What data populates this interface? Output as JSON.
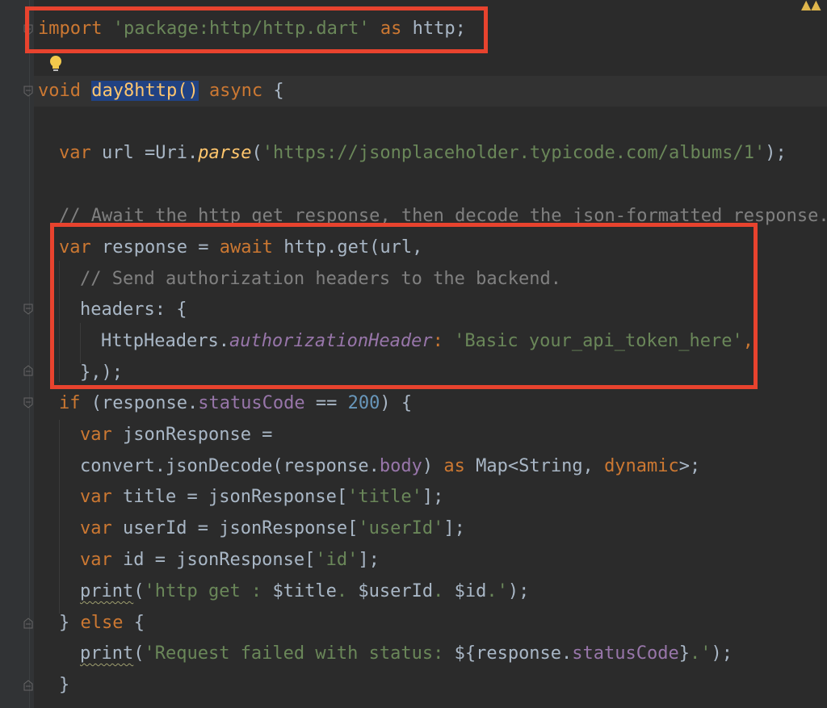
{
  "editor": {
    "warning_icon": "warning-icon",
    "bulb_icon": "lightbulb-icon",
    "lines": {
      "l1": {
        "kw1": "import",
        "str1": "'package:http/http.dart'",
        "kw2": "as",
        "rest": "http;"
      },
      "l3": {
        "kw": "void",
        "fn": "day8http()",
        "kw2": "async",
        "brace": "{"
      },
      "l5": {
        "kw": "var",
        "a": "url =Uri.",
        "m": "parse",
        "b": "(",
        "s": "'https://jsonplaceholder.typicode.com/albums/1'",
        "c": ");"
      },
      "l7": {
        "cm": "// Await the http get response, then decode the json-formatted response."
      },
      "l8": {
        "kw": "var",
        "a": "response =",
        "kw2": "await",
        "b": "http.get(url,",
        "c": ""
      },
      "l9": {
        "cm": "// Send authorization headers to the backend."
      },
      "l10": {
        "a": "headers: {"
      },
      "l11": {
        "a": "HttpHeaders.",
        "p": "authorizationHeader",
        "b": ":",
        "s": "'Basic your_api_token_here'",
        "c": ","
      },
      "l12": {
        "a": "},",
        "b": ");"
      },
      "l13": {
        "kw": "if",
        "a": "(response.",
        "p": "statusCode",
        "b": "==",
        "n": "200",
        "c": ") {"
      },
      "l14": {
        "kw": "var",
        "a": "jsonResponse ="
      },
      "l15": {
        "a": "convert.jsonDecode(response.",
        "p": "body",
        "b": ")",
        "kw": "as",
        "c": "Map<String,",
        "kw2": "dynamic",
        "d": ">;"
      },
      "l16": {
        "kw": "var",
        "a": "title = jsonResponse[",
        "s": "'title'",
        "b": "];"
      },
      "l17": {
        "kw": "var",
        "a": "userId = jsonResponse[",
        "s": "'userId'",
        "b": "];"
      },
      "l18": {
        "kw": "var",
        "a": "id = jsonResponse[",
        "s": "'id'",
        "b": "];"
      },
      "l19": {
        "f": "print",
        "a": "(",
        "s1": "'http get : ",
        "v": "$title",
        "s2": ". ",
        "v2": "$userId",
        "s3": ". ",
        "v3": "$id",
        "s4": ".'",
        "b": ");"
      },
      "l20": {
        "a": "}",
        "kw": "else",
        "b": "{"
      },
      "l21": {
        "f": "print",
        "a": "(",
        "s1": "'Request failed with status: ",
        "i1": "${response.",
        "p": "statusCode",
        "i2": "}",
        "s2": ".'",
        "b": ");"
      },
      "l22": {
        "a": "}"
      }
    },
    "colors": {
      "highlight_box": "#e8432e",
      "keyword": "#cc7832",
      "string": "#6a8759",
      "number": "#6897bb",
      "comment": "#808080",
      "property": "#9876aa"
    }
  }
}
